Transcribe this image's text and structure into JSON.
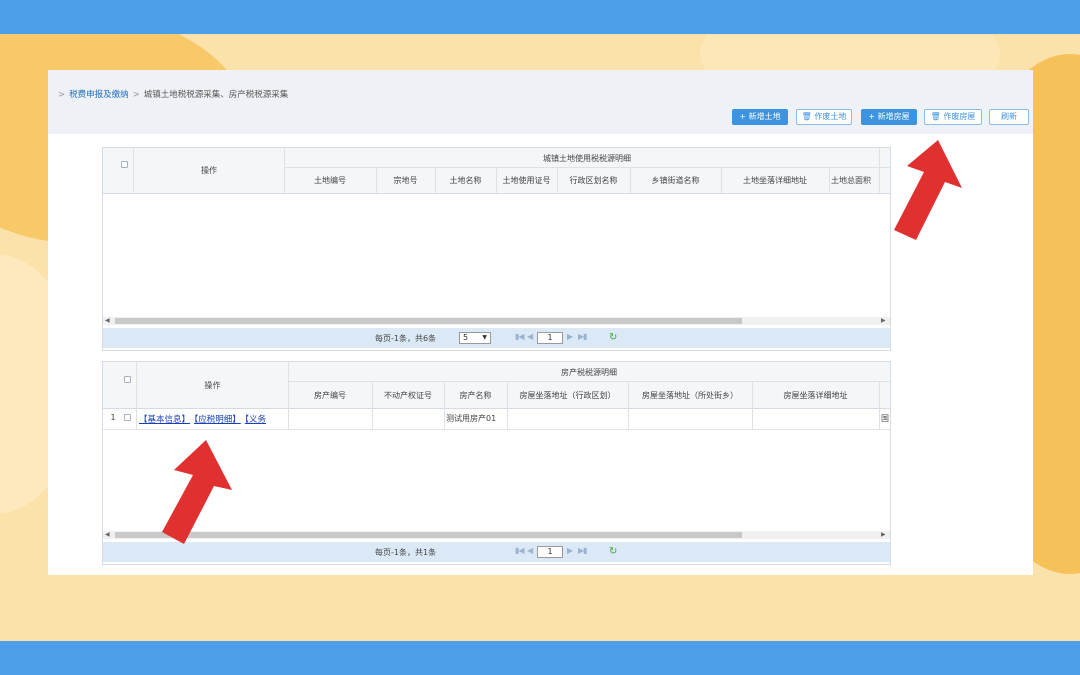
{
  "breadcrumb": {
    "sep1": ">",
    "parent": "税费申报及缴纳",
    "sep2": ">",
    "current": "城镇土地税税源采集、房产税税源采集"
  },
  "toolbar": {
    "add_land": "+ 新增土地",
    "void_land": "作废土地",
    "add_house": "+ 新增房屋",
    "void_house": "作废房屋",
    "refresh": "刷新"
  },
  "land_table": {
    "op_header": "操作",
    "group_title": "城镇土地使用税税源明细",
    "columns": [
      "土地编号",
      "宗地号",
      "土地名称",
      "土地使用证号",
      "行政区划名称",
      "乡镇街道名称",
      "土地坐落详细地址",
      "土地总面积"
    ],
    "pager": {
      "summary": "每页-1条，共6条",
      "page_size": "5",
      "page": "1"
    }
  },
  "house_table": {
    "op_header": "操作",
    "group_title": "房产税税源明细",
    "columns": [
      "房产编号",
      "不动产权证号",
      "房产名称",
      "房屋坐落地址（行政区划）",
      "房屋坐落地址（所处街乡）",
      "房屋坐落详细地址"
    ],
    "rows": [
      {
        "index": "1",
        "ops": [
          "【基本信息】",
          "【应税明细】",
          "【义务"
        ],
        "name": "测试用房产01",
        "tail": "国"
      }
    ],
    "pager": {
      "summary": "每页-1条，共1条",
      "page": "1"
    }
  },
  "colors": {
    "band": "#4e9fea",
    "primary": "#3c93e0",
    "arrow": "#e03030"
  },
  "icons": [
    "trash-icon",
    "refresh-icon",
    "first-page-icon",
    "prev-page-icon",
    "next-page-icon",
    "last-page-icon",
    "red-arrow"
  ]
}
